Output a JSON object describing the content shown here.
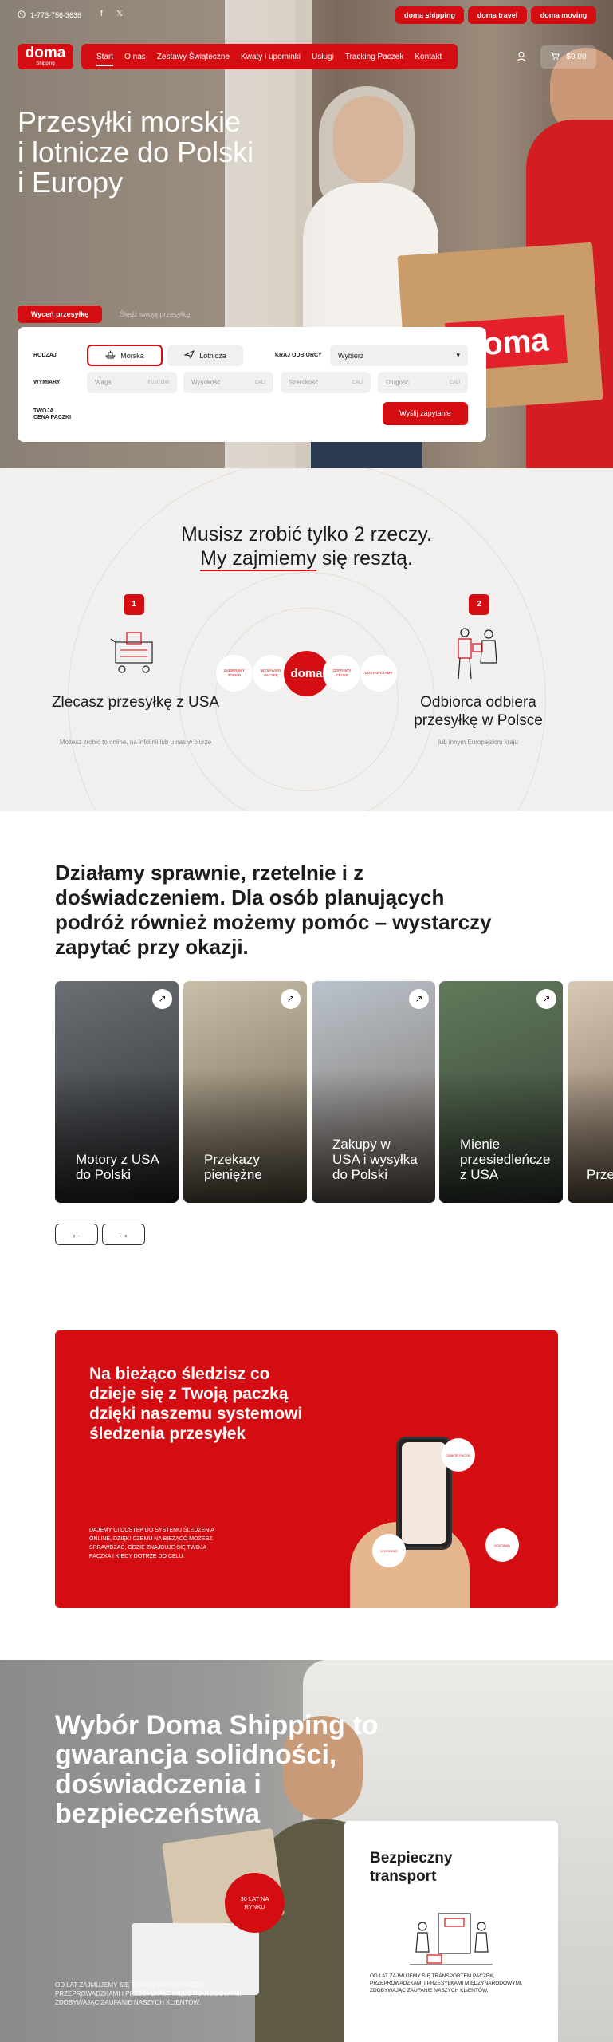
{
  "topbar": {
    "phone": "1-773-756-3636",
    "buttons": [
      "doma shipping",
      "doma travel",
      "doma moving"
    ]
  },
  "nav": {
    "logo_main": "doma",
    "logo_sub": "Shipping",
    "items": [
      "Start",
      "O nas",
      "Zestawy Świąteczne",
      "Kwaty i upominki",
      "Usługi",
      "Tracking Paczek",
      "Kontakt"
    ],
    "cart_total": "$0.00"
  },
  "hero": {
    "title_lines": [
      "Przesyłki morskie",
      "i lotnicze do Polski",
      "i Europy"
    ],
    "box_brand": "doma",
    "tab_active": "Wyceń przesyłkę",
    "tab_inactive": "Śledź swoją przesyłkę"
  },
  "quote_form": {
    "label_type": "RODZAJ",
    "mode_sea": "Morska",
    "mode_air": "Lotnicza",
    "label_country": "KRAJ ODBIORCY",
    "country_value": "Wybierz",
    "label_dims": "WYMIARY",
    "fields": [
      {
        "placeholder": "Waga",
        "unit": "FUNTÓW"
      },
      {
        "placeholder": "Wysokość",
        "unit": "CALI"
      },
      {
        "placeholder": "Szerokość",
        "unit": "CALI"
      },
      {
        "placeholder": "Długość",
        "unit": "CALI"
      }
    ],
    "label_price": "TWOJA\nCENA PACZKI",
    "submit": "Wyślij zapytanie"
  },
  "steps": {
    "title_line1": "Musisz zrobić tylko 2 rzeczy.",
    "title_line2_highlight": "My zajmiemy",
    "title_line2_rest": " się resztą.",
    "center_logo": "doma",
    "mini_circles": [
      "ZABIERAMY TOWAR",
      "WYSYŁAMY PACZKĘ",
      "ODPRAWY CELNE",
      "DOSTAWCZAMY"
    ],
    "step1": {
      "num": "1",
      "title": "Zlecasz przesyłkę z USA",
      "sub": "Możesz zrobić to online, na infolinii lub u nas w biurze"
    },
    "step2": {
      "num": "2",
      "title": "Odbiorca odbiera przesyłkę w Polsce",
      "sub": "lub innym Europejskim kraju"
    }
  },
  "services": {
    "title": "Działamy sprawnie, rzetelnie i z doświadczeniem. Dla osób planujących podróż również możemy pomóc – wystarczy zapytać przy okazji.",
    "cards": [
      {
        "label": "Motory z USA do Polski"
      },
      {
        "label": "Przekazy pieniężne"
      },
      {
        "label": "Zakupy w USA i wysyłka do Polski"
      },
      {
        "label": "Mienie przesiedleńcze z USA"
      },
      {
        "label": "Prze ki"
      }
    ],
    "prev": "←",
    "next": "→"
  },
  "tracking": {
    "title": "Na bieżąco śledzisz co dzieje się z Twoją paczką dzięki naszemu systemowi śledzenia przesyłek",
    "text": "DAJEMY CI DOSTĘP DO SYSTEMU ŚLEDZENIA ONLINE, DZIĘKI CZEMU NA BIEŻĄCO MOŻESZ SPRAWDZAĆ, GDZIE ZNAJDUJE SIĘ TWOJA PACZKA I KIEDY DOTRZE DO CELU.",
    "bubbles": [
      "ODBIÓR PACZKI",
      "W DRODZE",
      "DOSTAWA",
      "STATUS"
    ]
  },
  "choice": {
    "title": "Wybór Doma Shipping to gwarancja solidności, doświadczenia i bezpieczeństwa",
    "years_badge": "30 LAT NA RYNKU",
    "text": "OD LAT ZAJMUJEMY SIĘ TRANSPORTEM PACZEK, PRZEPROWADZKAMI I PRZESYŁKAMI MIĘDZYNARODOWYMI, ZDOBYWAJĄC ZAUFANIE NASZYCH KLIENTÓW.",
    "card_title": "Bezpieczny transport",
    "card_text": "OD LAT ZAJMUJEMY SIĘ TRANSPORTEM PACZEK, PRZEPROWADZKAMI I PRZESYŁKAMI MIĘDZYNARODOWYMI, ZDOBYWAJĄC ZAUFANIE NASZYCH KLIENTÓW."
  },
  "colors": {
    "brand": "#d40d12",
    "beige": "#f2f0ee"
  }
}
